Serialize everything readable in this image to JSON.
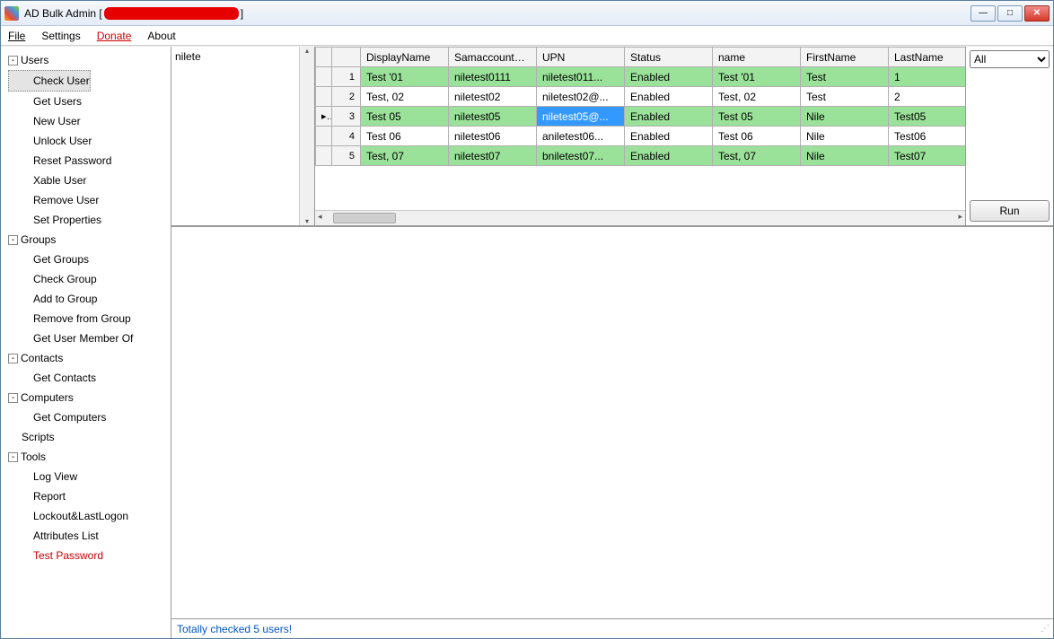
{
  "title": {
    "app": "AD Bulk Admin [",
    "close_bracket": "]"
  },
  "menu": {
    "file": "File",
    "settings": "Settings",
    "donate": "Donate",
    "about": "About"
  },
  "tree": {
    "users": {
      "label": "Users",
      "items": [
        "Check User",
        "Get Users",
        "New User",
        "Unlock User",
        "Reset Password",
        "Xable User",
        "Remove User",
        "Set Properties"
      ],
      "selected": 0
    },
    "groups": {
      "label": "Groups",
      "items": [
        "Get Groups",
        "Check Group",
        "Add to Group",
        "Remove from Group",
        "Get User Member Of"
      ]
    },
    "contacts": {
      "label": "Contacts",
      "items": [
        "Get Contacts"
      ]
    },
    "computers": {
      "label": "Computers",
      "items": [
        "Get Computers"
      ]
    },
    "scripts": {
      "label": "Scripts"
    },
    "tools": {
      "label": "Tools",
      "items": [
        "Log View",
        "Report",
        "Lockout&LastLogon",
        "Attributes List",
        "Test Password"
      ],
      "red": 4
    }
  },
  "input_text": "nilete",
  "grid": {
    "columns": [
      "DisplayName",
      "SamaccountName",
      "UPN",
      "Status",
      "name",
      "FirstName",
      "LastName"
    ],
    "rows": [
      {
        "n": "1",
        "ptr": "",
        "green": true,
        "cells": [
          "Test '01",
          "niletest0111",
          "niletest011...",
          "Enabled",
          "Test '01",
          "Test",
          "1"
        ]
      },
      {
        "n": "2",
        "ptr": "",
        "green": false,
        "cells": [
          "Test, 02",
          "niletest02",
          "niletest02@...",
          "Enabled",
          "Test, 02",
          "Test",
          "2"
        ]
      },
      {
        "n": "3",
        "ptr": "▸",
        "green": true,
        "cells": [
          "Test 05",
          "niletest05",
          "niletest05@...",
          "Enabled",
          "Test 05",
          "Nile",
          "Test05"
        ],
        "selcol": 2
      },
      {
        "n": "4",
        "ptr": "",
        "green": false,
        "cells": [
          "Test 06",
          "niletest06",
          "aniletest06...",
          "Enabled",
          "Test 06",
          "Nile",
          "Test06"
        ]
      },
      {
        "n": "5",
        "ptr": "",
        "green": true,
        "cells": [
          "Test, 07",
          "niletest07",
          "bniletest07...",
          "Enabled",
          "Test, 07",
          "Nile",
          "Test07"
        ]
      }
    ]
  },
  "filter": {
    "options": [
      "All"
    ],
    "selected": "All"
  },
  "run_label": "Run",
  "status": "Totally checked 5 users!"
}
